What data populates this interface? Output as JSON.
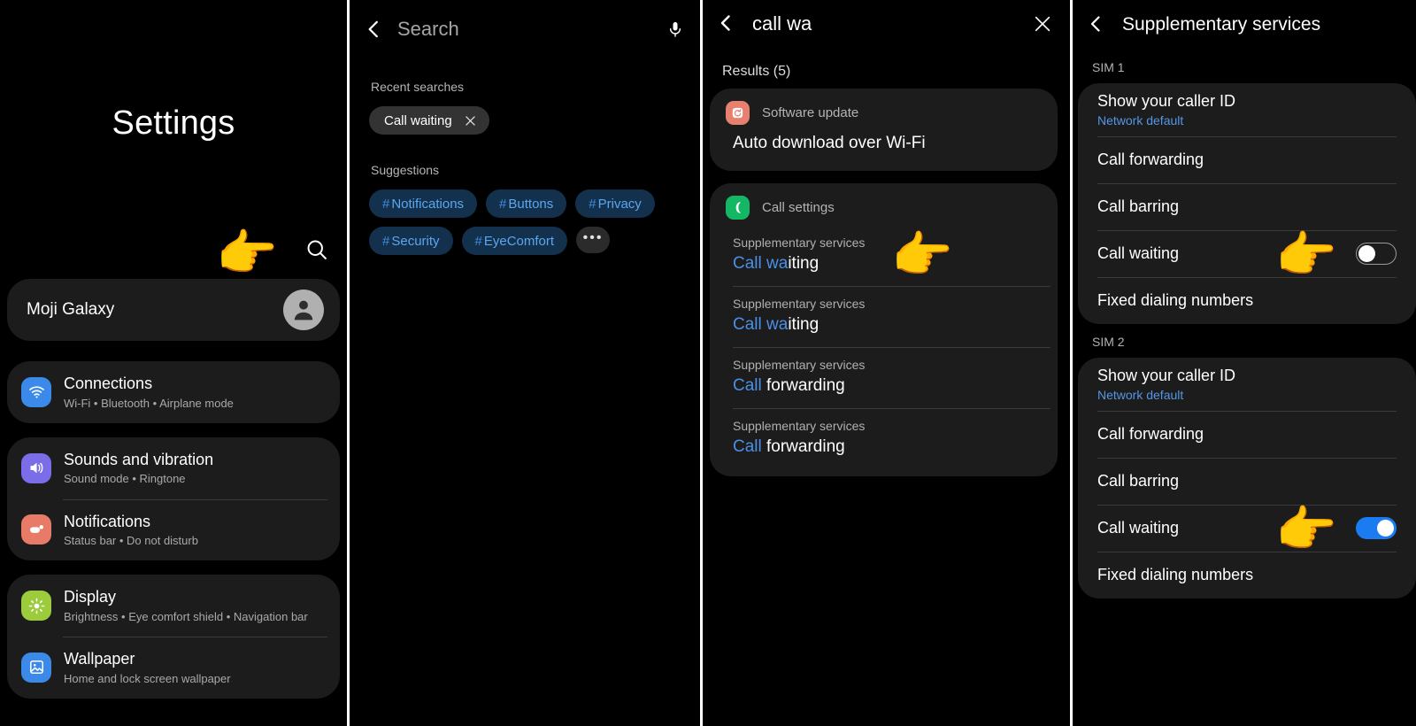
{
  "theme": {
    "bg": "#000000",
    "card": "#1c1c1c",
    "accent_blue": "#4a90e8",
    "chip_blue_bg": "#13304d",
    "chip_blue_text": "#5aa7f0",
    "toggle_on": "#1a7cf0",
    "hand_color": "#f5b731"
  },
  "panel_settings": {
    "title": "Settings",
    "search_icon": "search-icon",
    "pointer_icon": "pointing-hand-right",
    "profile": {
      "name": "Moji Galaxy",
      "avatar_icon": "person-avatar-icon"
    },
    "groups": [
      {
        "items": [
          {
            "title": "Connections",
            "subtitle": "Wi-Fi  •  Bluetooth  •  Airplane mode",
            "icon": "wifi-icon",
            "icon_color": "#3b8aea"
          }
        ]
      },
      {
        "items": [
          {
            "title": "Sounds and vibration",
            "subtitle": "Sound mode  •  Ringtone",
            "icon": "speaker-volume-icon",
            "icon_color": "#7b6ce8"
          },
          {
            "title": "Notifications",
            "subtitle": "Status bar  •  Do not disturb",
            "icon": "notification-bubble-icon",
            "icon_color": "#e87a68"
          }
        ]
      },
      {
        "items": [
          {
            "title": "Display",
            "subtitle": "Brightness  •  Eye comfort shield  •  Navigation bar",
            "icon": "brightness-sun-icon",
            "icon_color": "#9ccb3b"
          },
          {
            "title": "Wallpaper",
            "subtitle": "Home and lock screen wallpaper",
            "icon": "image-picture-icon",
            "icon_color": "#3b8aea"
          }
        ]
      }
    ]
  },
  "panel_search": {
    "back_icon": "chevron-left-icon",
    "placeholder": "Search",
    "mic_icon": "microphone-icon",
    "recent_label": "Recent searches",
    "recent": [
      {
        "label": "Call waiting",
        "remove_icon": "close-x-icon"
      }
    ],
    "suggestions_label": "Suggestions",
    "suggestions": [
      {
        "hash": "#",
        "label": "Notifications"
      },
      {
        "hash": "#",
        "label": "Buttons"
      },
      {
        "hash": "#",
        "label": "Privacy"
      },
      {
        "hash": "#",
        "label": "Security"
      },
      {
        "hash": "#",
        "label": "EyeComfort"
      }
    ],
    "more_label": "•••"
  },
  "panel_results": {
    "back_icon": "chevron-left-icon",
    "query": "call wa",
    "clear_icon": "close-x-icon",
    "results_count_label": "Results (5)",
    "cards": [
      {
        "category": "Software update",
        "icon": "software-update-icon",
        "icon_color": "#e8806f",
        "main_result": "Auto download over Wi-Fi"
      },
      {
        "category": "Call settings",
        "icon": "phone-call-icon",
        "icon_color": "#14b864",
        "items": [
          {
            "sub": "Supplementary services",
            "highlight": "Call wa",
            "rest": "iting",
            "pointer": true
          },
          {
            "sub": "Supplementary services",
            "highlight": "Call wa",
            "rest": "iting",
            "pointer": false
          },
          {
            "sub": "Supplementary services",
            "highlight": "Call",
            "rest": " forwarding",
            "pointer": false
          },
          {
            "sub": "Supplementary services",
            "highlight": "Call",
            "rest": " forwarding",
            "pointer": false
          }
        ]
      }
    ]
  },
  "panel_supplementary": {
    "back_icon": "chevron-left-icon",
    "title": "Supplementary services",
    "sections": [
      {
        "label": "SIM 1",
        "rows": [
          {
            "label": "Show your caller ID",
            "value": "Network default",
            "toggle": null
          },
          {
            "label": "Call forwarding",
            "value": null,
            "toggle": null
          },
          {
            "label": "Call barring",
            "value": null,
            "toggle": null
          },
          {
            "label": "Call waiting",
            "value": null,
            "toggle": "off",
            "pointer": true
          },
          {
            "label": "Fixed dialing numbers",
            "value": null,
            "toggle": null
          }
        ]
      },
      {
        "label": "SIM 2",
        "rows": [
          {
            "label": "Show your caller ID",
            "value": "Network default",
            "toggle": null
          },
          {
            "label": "Call forwarding",
            "value": null,
            "toggle": null
          },
          {
            "label": "Call barring",
            "value": null,
            "toggle": null
          },
          {
            "label": "Call waiting",
            "value": null,
            "toggle": "on",
            "pointer": true
          },
          {
            "label": "Fixed dialing numbers",
            "value": null,
            "toggle": null
          }
        ]
      }
    ]
  }
}
